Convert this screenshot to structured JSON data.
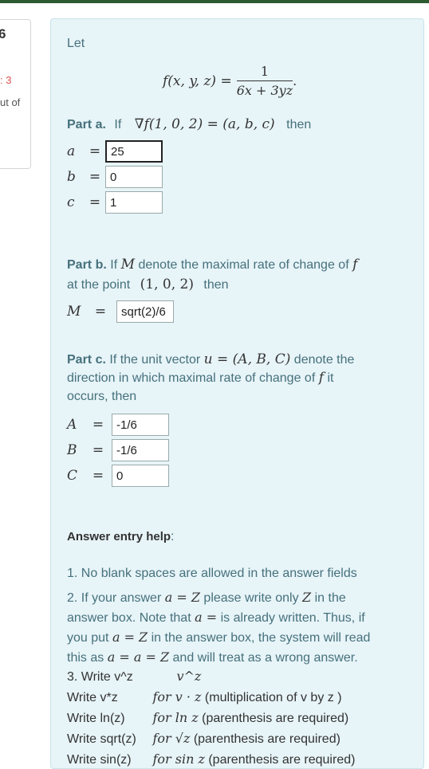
{
  "left_card": {
    "number": "6",
    "red_text": ": 3",
    "out_of": "ut of"
  },
  "problem": {
    "intro": "Let",
    "function_lhs": "f(x, y, z) =",
    "function_num": "1",
    "function_den": "6x + 3yz",
    "function_end": ".",
    "part_a": {
      "label": "Part a.",
      "if_text": "If",
      "expr": "∇f(1, 0, 2) = (a, b, c)",
      "then_text": "then",
      "answers": [
        {
          "var": "a",
          "value": "25"
        },
        {
          "var": "b",
          "value": "0"
        },
        {
          "var": "c",
          "value": "1"
        }
      ]
    },
    "part_b": {
      "label": "Part b.",
      "text1": "If",
      "M": "M",
      "text2": "denote the maximal rate of change of",
      "f": "f",
      "text3": "at the point",
      "point": "(1, 0, 2)",
      "text4": "then",
      "answer_var": "M",
      "answer_value": "sqrt(2)/6"
    },
    "part_c": {
      "label": "Part c.",
      "text1": "If the unit vector",
      "vec": "u = (A, B, C)",
      "text2": "denote the",
      "line2a": "direction in which maximal rate of change of",
      "f": "f",
      "line2b": "it",
      "line3": "occurs, then",
      "answers": [
        {
          "var": "A",
          "value": "-1/6"
        },
        {
          "var": "B",
          "value": "-1/6"
        },
        {
          "var": "C",
          "value": "0"
        }
      ]
    },
    "help": {
      "title": "Answer entry help",
      "colon": ":",
      "item1": "1. No blank spaces are allowed in the answer fields",
      "item2_l1a": "2. If your answer",
      "item2_l1m": "a = Z",
      "item2_l1b": "please write only",
      "item2_l1z": "Z",
      "item2_l1c": "in the",
      "item2_l2a": "answer box. Note that",
      "item2_l2m": "a =",
      "item2_l2b": "is already written. Thus, if",
      "item2_l3a": "you put",
      "item2_l3m": "a = Z",
      "item2_l3b": "in the answer box, the system will read",
      "item2_l4a": "this as",
      "item2_l4m": "a = a = Z",
      "item2_l4b": "and will treat as a wrong answer.",
      "table": [
        {
          "write": "3. Write v^z",
          "math": "v^z",
          "note": ""
        },
        {
          "write": "Write v*z",
          "math": "for v · z",
          "note": "(multiplication of v by z )"
        },
        {
          "write": "Write ln(z)",
          "math": "for ln z",
          "note": "(parenthesis are required)"
        },
        {
          "write": "Write sqrt(z)",
          "math": "for √z",
          "note": "(parenthesis are required)"
        },
        {
          "write": "Write sin(z)",
          "math": "for sin z",
          "note": "(parenthesis are required)"
        }
      ]
    }
  }
}
